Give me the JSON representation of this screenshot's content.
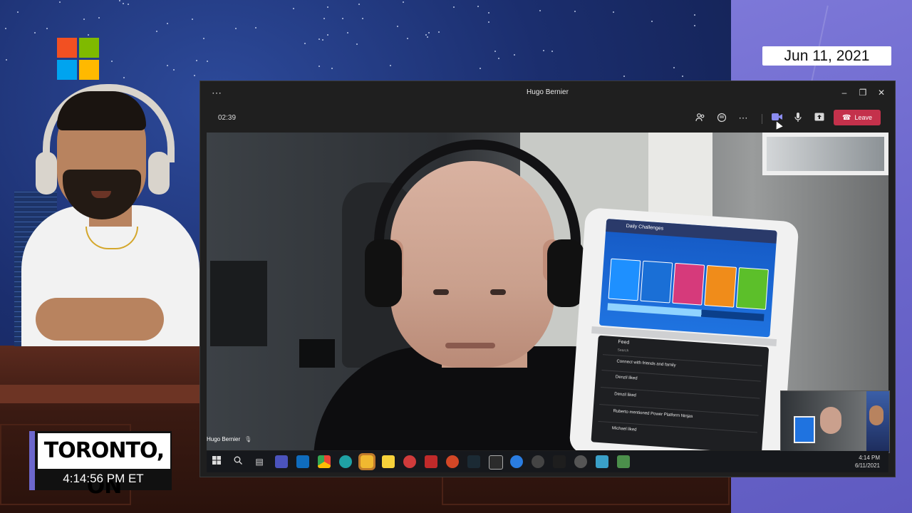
{
  "overlay": {
    "date": "Jun 11, 2021",
    "location": "TORONTO, ON",
    "time": "4:14:56 PM ET"
  },
  "colors": {
    "ms_red": "#f25022",
    "ms_green": "#7fba00",
    "ms_blue": "#00a4ef",
    "ms_yellow": "#ffb900",
    "teams_accent": "#6264a7",
    "leave_red": "#c4314b"
  },
  "teams": {
    "window_title": "Hugo Bernier",
    "more_menu_icon": "ellipsis-icon",
    "call_timer": "02:39",
    "toolbar": {
      "participants_icon": "people-icon",
      "chat_icon": "chat-icon",
      "more_icon": "ellipsis-icon",
      "camera_icon": "video-camera-icon",
      "mic_icon": "microphone-icon",
      "share_icon": "share-screen-icon",
      "leave_label": "Leave"
    },
    "participant_name": "Hugo Bernier",
    "device": {
      "top_header": "Daily Challenges",
      "bottom_header": "Feed",
      "search_placeholder": "Search",
      "feed_items": [
        {
          "title": "Connect with friends and family"
        },
        {
          "title": "Denzil liked"
        },
        {
          "title": "Denzil liked"
        },
        {
          "title": "Ruberto mentioned Power Platform Ninjas"
        },
        {
          "title": "Michael liked"
        }
      ]
    },
    "taskbar": {
      "time": "4:14 PM",
      "date": "6/11/2021"
    }
  }
}
